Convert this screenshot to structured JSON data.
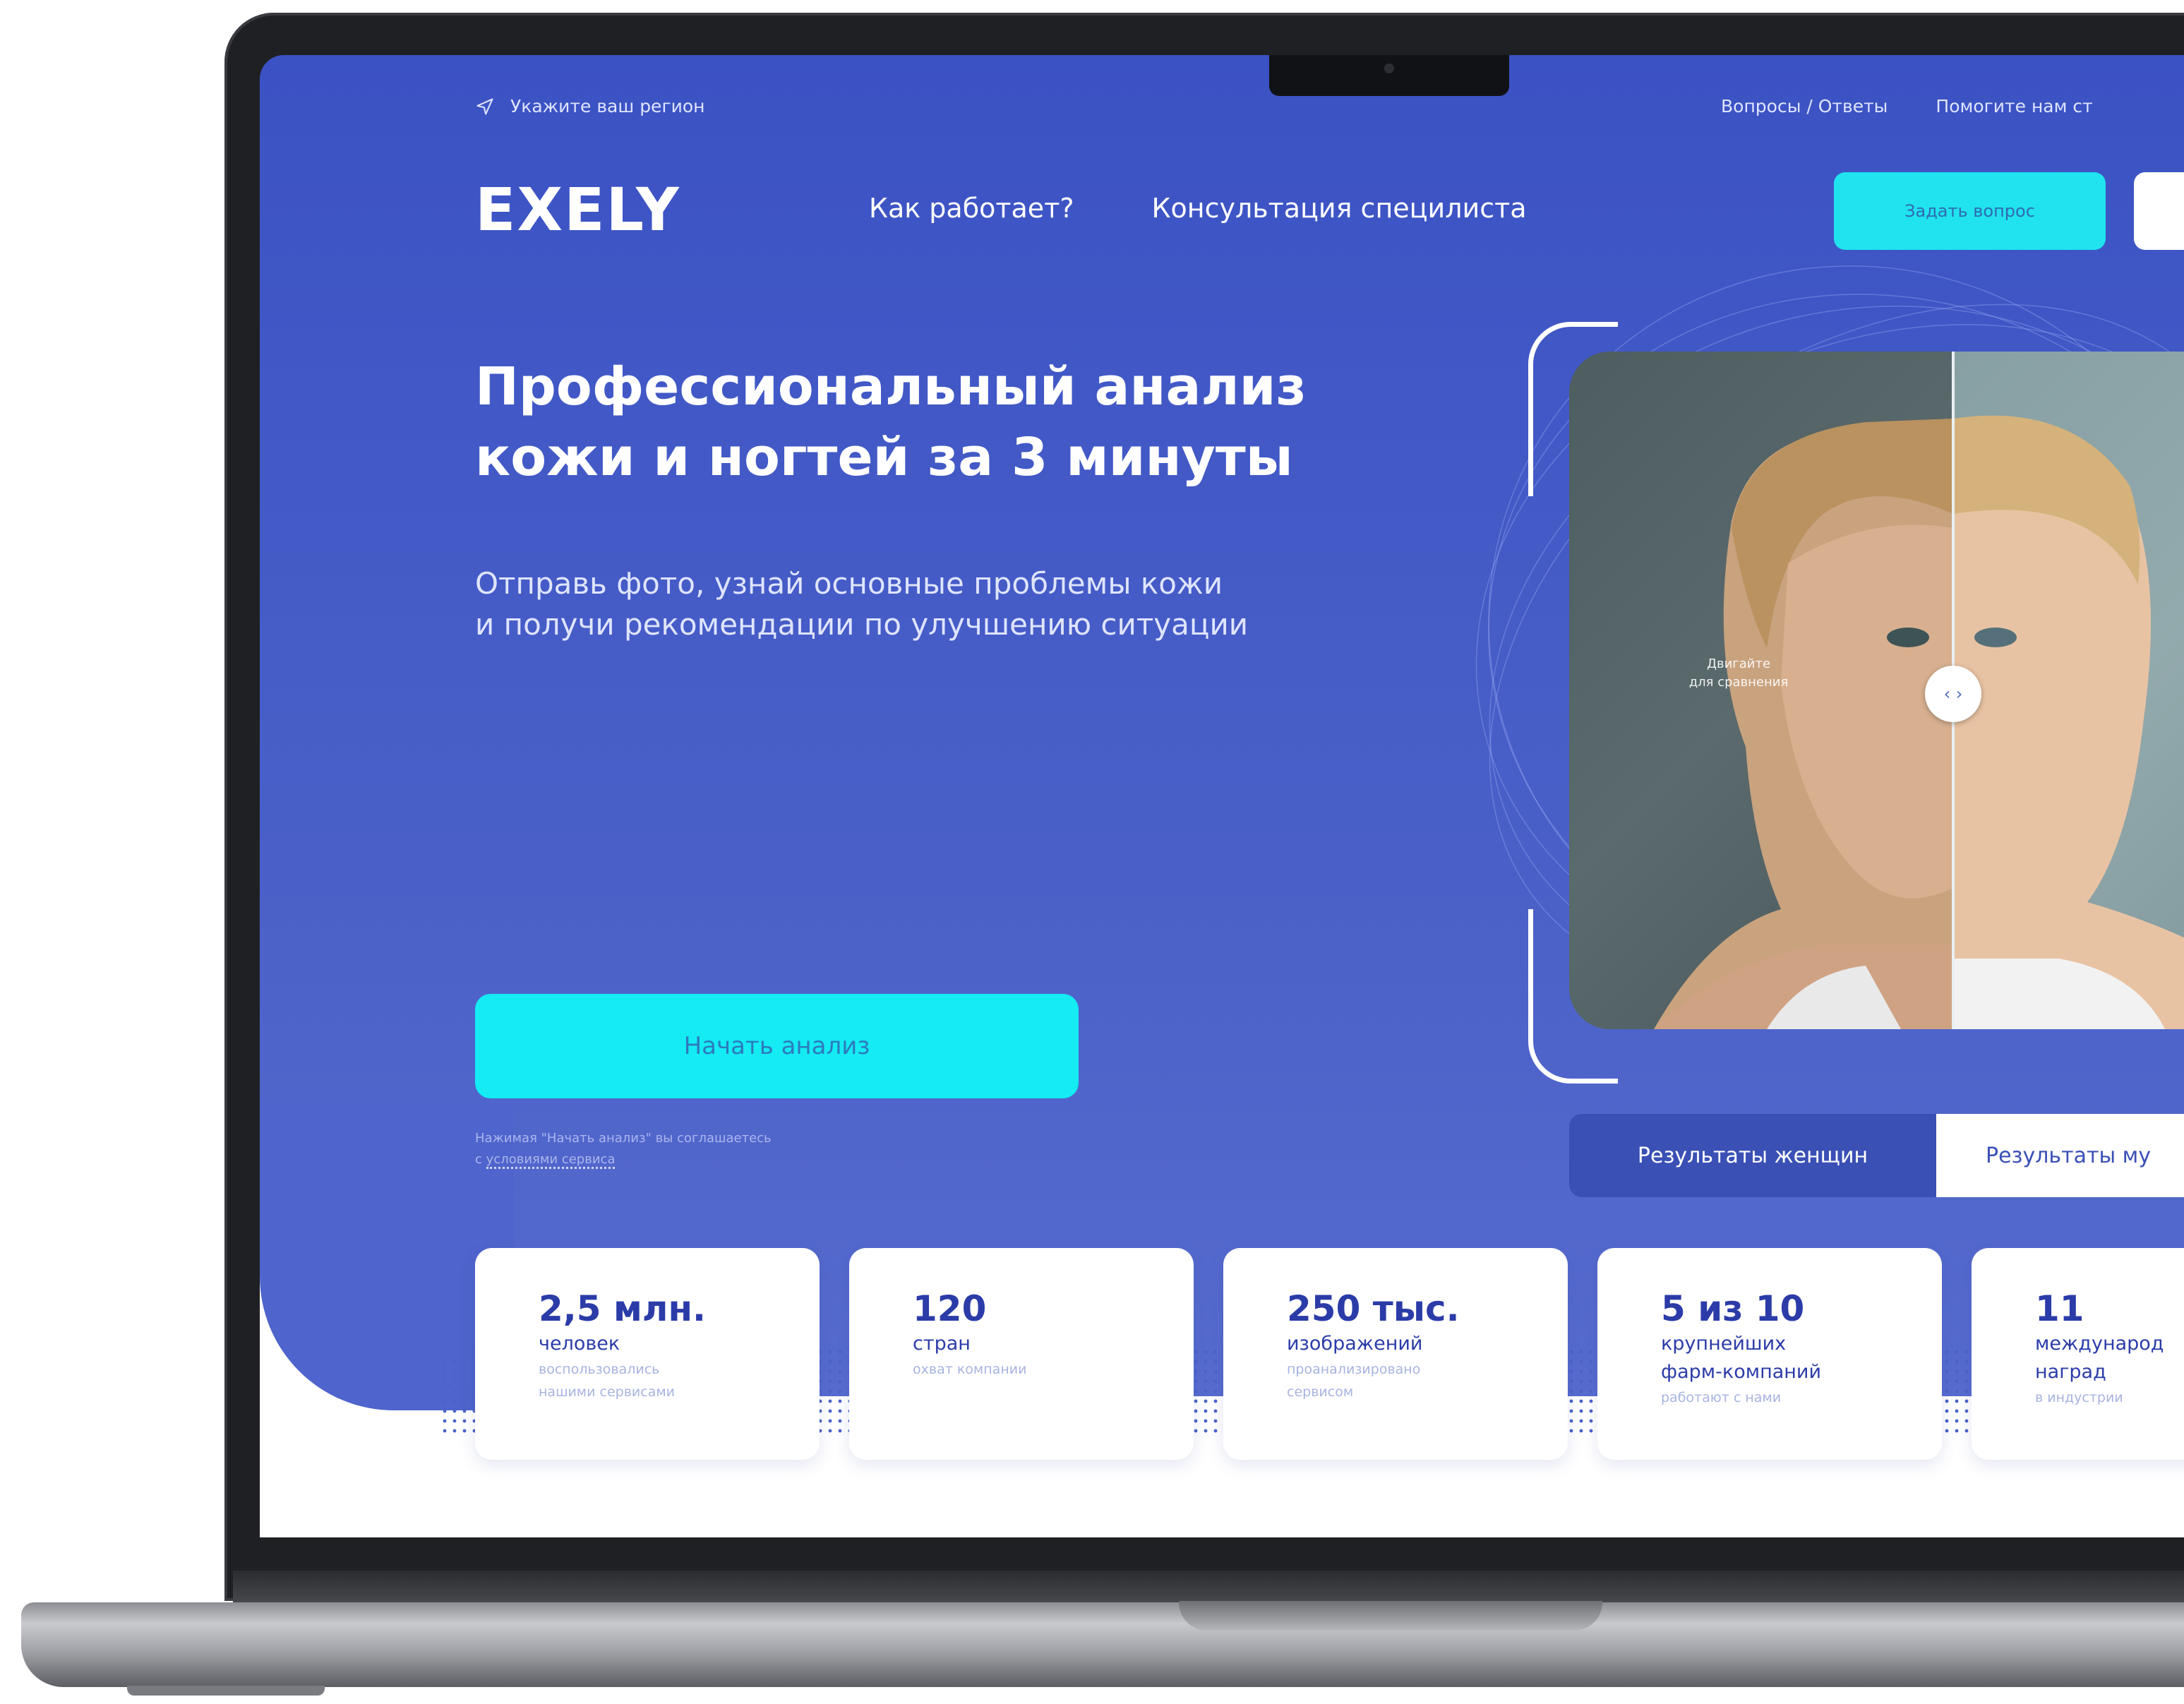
{
  "top_bar": {
    "region_label": "Укажите ваш регион",
    "links": [
      "Вопросы / Ответы",
      "Помогите нам ст"
    ]
  },
  "header": {
    "logo": "EXELY",
    "nav": [
      "Как работает?",
      "Консультация специлиста"
    ],
    "ask_button": "Задать вопрос"
  },
  "hero": {
    "title_line1": "Профессиональный анализ",
    "title_line2": "кожи и ногтей за 3 минуты",
    "subtitle_line1": "Отправь фото, узнай основные проблемы кожи",
    "subtitle_line2": "и получи рекомендации по улучшению ситуации",
    "start_button": "Начать анализ",
    "consent_line1": "Нажимая \"Начать анализ\" вы соглашаетесь",
    "consent_prefix": "с",
    "consent_link": "условиями сервиса"
  },
  "comparer": {
    "hint_line1": "Двигайте",
    "hint_line2": "для сравнения",
    "handle_glyph": "‹ ›"
  },
  "tabs": {
    "women": "Результаты женщин",
    "men": "Результаты му"
  },
  "stats": [
    {
      "value": "2,5 млн.",
      "label": "человек",
      "desc": "воспользовались\nнашими сервисами"
    },
    {
      "value": "120",
      "label": "стран",
      "desc": "охват компании"
    },
    {
      "value": "250 тыс.",
      "label": "изображений",
      "desc": "проанализировано\nсервисом"
    },
    {
      "value": "5 из 10",
      "label": "крупнейших\nфарм-компаний",
      "desc": "работают с нами"
    },
    {
      "value": "11",
      "label": "международ\nнаград",
      "desc": "в индустрии"
    }
  ],
  "colors": {
    "screen_blue": "#3b52c4",
    "accent_cyan": "#14ebf3",
    "stat_text": "#2b3ca8"
  }
}
